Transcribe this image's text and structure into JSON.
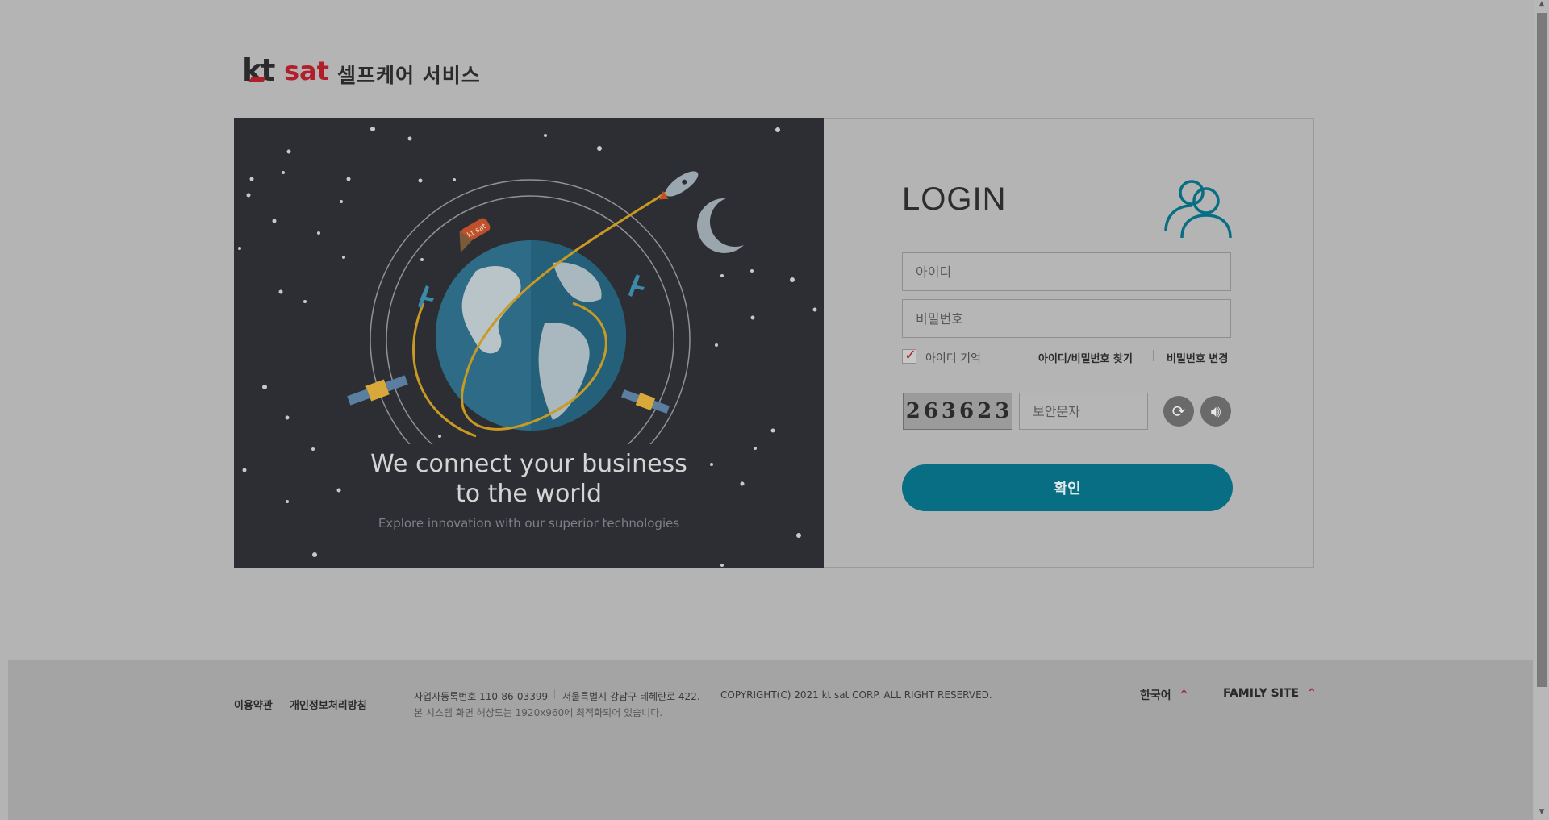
{
  "brand": {
    "logo_kt": "kt",
    "logo_sat": "sat",
    "service_title": "셀프케어 서비스"
  },
  "illustration": {
    "rocket_label": "kt sat",
    "tagline_line1": "We connect your business",
    "tagline_line2": "to the world",
    "tagline_sub": "Explore innovation with our superior technologies"
  },
  "login": {
    "title": "LOGIN",
    "id_placeholder": "아이디",
    "pw_placeholder": "비밀번호",
    "remember_label": "아이디 기억",
    "remember_checked": true,
    "find_link": "아이디/비밀번호 찾기",
    "change_link": "비밀번호 변경",
    "captcha_digits": [
      "2",
      "6",
      "3",
      "6",
      "2",
      "3"
    ],
    "captcha_placeholder": "보안문자",
    "refresh_icon": "refresh-icon",
    "audio_icon": "speaker-icon",
    "confirm_label": "확인",
    "accent_color": "#086e83"
  },
  "footer": {
    "terms": "이용약관",
    "privacy": "개인정보처리방침",
    "biz_no": "사업자등록번호 110-86-03399",
    "address": "서울특별시 강남구 테헤란로 422.",
    "copyright": "COPYRIGHT(C) 2021 kt sat CORP. ALL RIGHT RESERVED.",
    "resolution": "본 시스템 화면 해상도는 1920x960에 최적화되어 있습니다.",
    "language": "한국어",
    "family_site": "FAMILY SITE"
  }
}
